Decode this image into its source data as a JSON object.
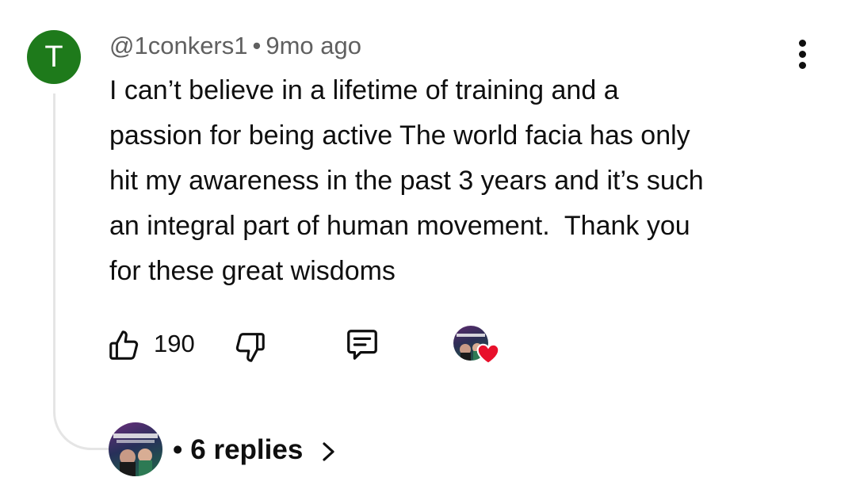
{
  "comment": {
    "avatar_letter": "T",
    "avatar_color": "#1e7a1b",
    "author": "@1conkers1",
    "separator": "•",
    "time": "9mo ago",
    "text": "I can’t believe in a lifetime of training and a\npassion for being active The world facia has only\nhit my awareness in the past 3 years and it’s such\nan integral part of human movement.  Thank you\nfor these great wisdoms",
    "more_icon": "vertical-dots-icon"
  },
  "actions": {
    "like_icon": "thumbs-up-icon",
    "like_count": "190",
    "dislike_icon": "thumbs-down-icon",
    "reply_icon": "comment-icon",
    "creator_heart_icon": "heart-icon",
    "heart_color": "#e8102b"
  },
  "replies": {
    "separator": "•",
    "label": "6 replies",
    "chevron_icon": "chevron-right-icon"
  }
}
